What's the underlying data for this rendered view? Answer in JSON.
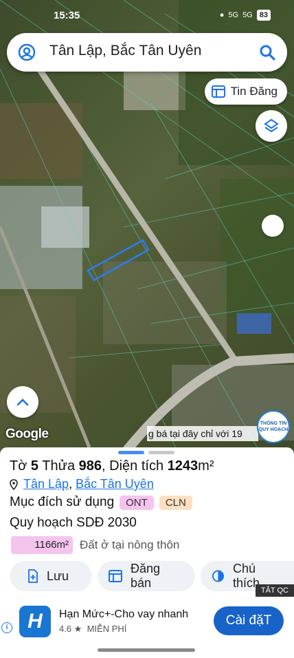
{
  "status": {
    "time": "15:35",
    "signal1": "5G",
    "signal2": "5G",
    "battery": "83"
  },
  "search": {
    "query": "Tân Lập, Bắc Tân Uyên"
  },
  "map": {
    "tin_dang_label": "Tin Đăng",
    "google_label": "Google",
    "ticker_text": "g bá tại đây chỉ với 19",
    "badge_text": "THÔNG TIN QUY HOẠCH"
  },
  "parcel": {
    "to_label": "Tờ",
    "to_value": "5",
    "thua_label": "Thửa",
    "thua_value": "986",
    "area_label": "Diện tích",
    "area_value": "1243",
    "area_unit": "m²",
    "commune": "Tân Lập",
    "district": "Bắc Tân Uyên",
    "separator": ",",
    "purpose_label": "Mục đích sử dụng",
    "tags": [
      {
        "code": "ONT",
        "color": "#f4c4ef"
      },
      {
        "code": "CLN",
        "color": "#fde0c2"
      }
    ],
    "plan_label": "Quy hoạch SDĐ 2030",
    "plan_area": "1166m²",
    "plan_desc": "Đất ở tại nông thôn"
  },
  "actions": {
    "save": "Lưu",
    "post": "Đăng bán",
    "legend": "Chú thích"
  },
  "ad": {
    "tat_qc": "TẮT QC",
    "logo_letter": "H",
    "name": "Hạn Mức+-Cho vay nhanh",
    "rating": "4.6 ★",
    "price": "MIỄN PHÍ",
    "install": "Cài đặT"
  },
  "colors": {
    "accent": "#1a73e8",
    "handle_active": "#4a8df0",
    "handle_inactive": "#c8c8c8",
    "plan_pill": "#f4c4ef"
  }
}
